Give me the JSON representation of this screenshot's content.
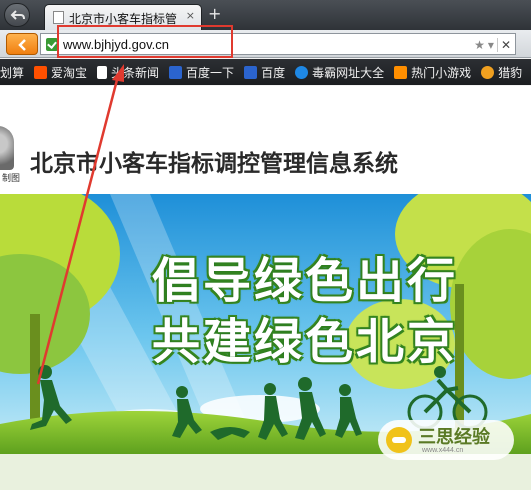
{
  "browser": {
    "tab": {
      "title": "北京市小客车指标管",
      "close": "×"
    },
    "new_tab": "+",
    "url": "www.bjhjyd.gov.cn",
    "bookmarks": [
      {
        "label": "划算",
        "icon": "partial-icon",
        "color": "#d9534f"
      },
      {
        "label": "爱淘宝",
        "icon": "taobao-icon",
        "color": "#ff5000"
      },
      {
        "label": "头条新闻",
        "icon": "page-icon",
        "color": "#ffffff"
      },
      {
        "label": "百度一下",
        "icon": "baidu-paw-icon",
        "color": "#2b64ce"
      },
      {
        "label": "百度",
        "icon": "baidu-paw-icon",
        "color": "#2b64ce"
      },
      {
        "label": "毒霸网址大全",
        "icon": "duba-icon",
        "color": "#1e88e5"
      },
      {
        "label": "热门小游戏",
        "icon": "game-icon",
        "color": "#ff8f00"
      },
      {
        "label": "猎豹",
        "icon": "liebao-icon",
        "color": "#f0a020"
      }
    ]
  },
  "page": {
    "logo_text": "制图",
    "title": "北京市小客车指标调控管理信息系统",
    "banner": {
      "line1": "倡导绿色出行",
      "line2": "共建绿色北京"
    }
  },
  "watermark": {
    "name": "三思经验",
    "url": "www.x444.cn"
  },
  "colors": {
    "annotation_red": "#e03a2f",
    "banner_green": "#3a8a1f",
    "sky_blue": "#3aa0e0"
  }
}
